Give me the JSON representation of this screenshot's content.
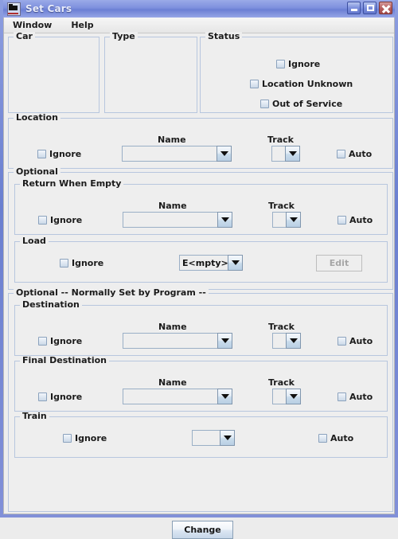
{
  "window": {
    "title": "Set Cars",
    "icon": "locomotive-icon",
    "controls": {
      "minimize": "minimize",
      "maximize": "maximize",
      "close": "close"
    }
  },
  "menubar": {
    "items": [
      {
        "label": "Window"
      },
      {
        "label": "Help"
      }
    ]
  },
  "labels": {
    "name": "Name",
    "track": "Track",
    "ignore": "Ignore",
    "auto": "Auto"
  },
  "panels": {
    "car": {
      "title": "Car"
    },
    "type": {
      "title": "Type"
    },
    "status": {
      "title": "Status",
      "checkboxes": [
        {
          "label": "Ignore",
          "checked": false
        },
        {
          "label": "Location Unknown",
          "checked": false
        },
        {
          "label": "Out of Service",
          "checked": false
        }
      ]
    },
    "location": {
      "title": "Location",
      "ignore": "Ignore",
      "name_label": "Name",
      "name_value": "",
      "track_label": "Track",
      "track_value": "",
      "auto": "Auto"
    },
    "optional": {
      "title": "Optional",
      "return_when_empty": {
        "title": "Return When Empty",
        "ignore": "Ignore",
        "name_label": "Name",
        "name_value": "",
        "track_label": "Track",
        "track_value": "",
        "auto": "Auto"
      },
      "load": {
        "title": "Load",
        "ignore": "Ignore",
        "load_value": "E<mpty>",
        "edit_button": "Edit",
        "edit_enabled": false
      }
    },
    "optional_program": {
      "title": "Optional -- Normally Set by Program --",
      "destination": {
        "title": "Destination",
        "ignore": "Ignore",
        "name_label": "Name",
        "name_value": "",
        "track_label": "Track",
        "track_value": "",
        "auto": "Auto"
      },
      "final_destination": {
        "title": "Final Destination",
        "ignore": "Ignore",
        "name_label": "Name",
        "name_value": "",
        "track_label": "Track",
        "track_value": "",
        "auto": "Auto"
      },
      "train": {
        "title": "Train",
        "ignore": "Ignore",
        "train_value": "",
        "auto": "Auto"
      }
    }
  },
  "footer": {
    "change_button": "Change"
  },
  "colors": {
    "window_frame": "#7e90de",
    "panel_bg": "#eeeeee",
    "panel_border": "#b7c6de",
    "close_button": "#b86060"
  }
}
